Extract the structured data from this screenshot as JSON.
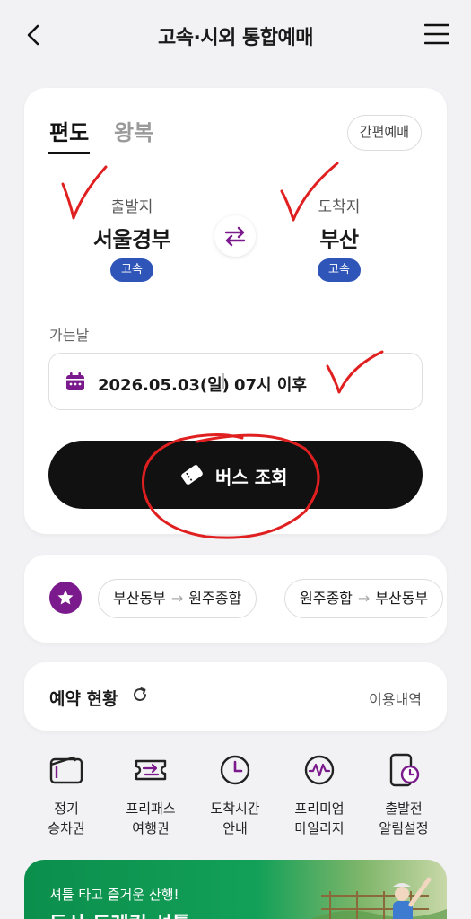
{
  "header": {
    "title": "고속·시외 통합예매"
  },
  "trip_tabs": {
    "oneway": "편도",
    "round": "왕복"
  },
  "quick_booking_label": "간편예매",
  "departure": {
    "label": "출발지",
    "name": "서울경부",
    "badge": "고속"
  },
  "arrival": {
    "label": "도착지",
    "name": "부산",
    "badge": "고속"
  },
  "date_section": {
    "label": "가는날",
    "date": "2026.05.03(일)",
    "time": "07시 이후"
  },
  "search_button": "버스 조회",
  "favorites": [
    {
      "from": "부산동부",
      "arrow": "→",
      "to": "원주종합"
    },
    {
      "from": "원주종합",
      "arrow": "→",
      "to": "부산동부"
    }
  ],
  "reservation": {
    "title": "예약 현황",
    "history_link": "이용내역"
  },
  "quick_menu": [
    {
      "line1": "정기",
      "line2": "승차권",
      "icon": "wallet-icon"
    },
    {
      "line1": "프리패스",
      "line2": "여행권",
      "icon": "pass-icon"
    },
    {
      "line1": "도착시간",
      "line2": "안내",
      "icon": "clock-icon"
    },
    {
      "line1": "프리미엄",
      "line2": "마일리지",
      "icon": "mileage-icon"
    },
    {
      "line1": "출발전",
      "line2": "알림설정",
      "icon": "phone-alarm-icon"
    }
  ],
  "banner": {
    "subtitle": "셔틀 타고 즐거운 산행!",
    "title": "등산 트레킹 셔틀"
  },
  "colors": {
    "accent_purple": "#7b1a8c",
    "badge_blue": "#2f55b8",
    "button_black": "#111111",
    "annotation_red": "#e02020"
  }
}
